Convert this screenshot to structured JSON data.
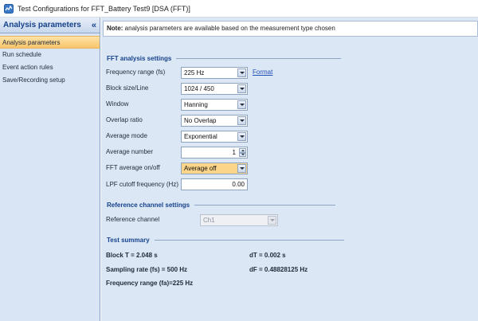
{
  "window": {
    "title": "Test Configurations for FFT_Battery Test9 [DSA (FFT)]"
  },
  "sidebar": {
    "title": "Analysis parameters",
    "collapse_glyph": "«",
    "items": [
      {
        "label": "Analysis parameters",
        "active": true
      },
      {
        "label": "Run schedule"
      },
      {
        "label": "Event action rules"
      },
      {
        "label": "Save/Recording setup"
      }
    ]
  },
  "note": {
    "prefix": "Note:",
    "text": " analysis parameters are available based on the measurement type chosen"
  },
  "fft": {
    "title": "FFT analysis settings",
    "frequency_range": {
      "label": "Frequency range (fs)",
      "value": "225 Hz",
      "link": "Format"
    },
    "block_size": {
      "label": "Block size/Line",
      "value": "1024 / 450"
    },
    "window": {
      "label": "Window",
      "value": "Hanning"
    },
    "overlap": {
      "label": "Overlap ratio",
      "value": "No Overlap"
    },
    "avg_mode": {
      "label": "Average mode",
      "value": "Exponential"
    },
    "avg_number": {
      "label": "Average number",
      "value": "1"
    },
    "fft_avg": {
      "label": "FFT average on/off",
      "value": "Average off"
    },
    "lpf": {
      "label": "LPF cutoff frequency (Hz)",
      "value": "0.00"
    }
  },
  "reference": {
    "title": "Reference channel settings",
    "channel": {
      "label": "Reference channel",
      "value": "Ch1"
    }
  },
  "summary": {
    "title": "Test summary",
    "block_t": "Block T = 2.048 s",
    "dt": "dT = 0.002 s",
    "sampling": "Sampling rate (fs) = 500 Hz",
    "df": "dF = 0.48828125 Hz",
    "freq": "Frequency range (fa)=225 Hz"
  },
  "colors": {
    "accent": "#15428b",
    "active_item": "#f9c56b",
    "panel": "#dce7f5"
  }
}
